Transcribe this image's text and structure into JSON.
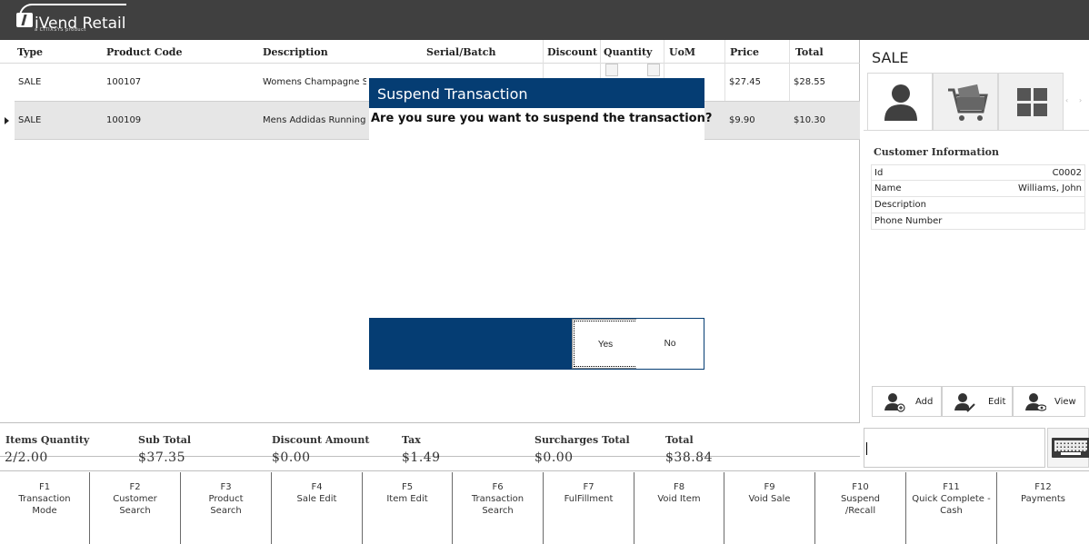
{
  "app": {
    "logo_text": "iVend Retail",
    "logo_sub": "a CITIXSYS product"
  },
  "grid": {
    "columns": [
      "Type",
      "Product Code",
      "Description",
      "Serial/Batch",
      "Discount",
      "Quantity",
      "UoM",
      "Price",
      "Total"
    ],
    "rows": [
      {
        "type": "SALE",
        "code": "100107",
        "description": "Womens Champagne S",
        "price": "$27.45",
        "total": "$28.55"
      },
      {
        "type": "SALE",
        "code": "100109",
        "description": "Mens Addidas Running",
        "price": "$9.90",
        "total": "$10.30"
      }
    ]
  },
  "right_panel": {
    "title": "SALE",
    "tabs": [
      "customer-icon",
      "cart-icon",
      "grid-icon"
    ],
    "customer_info_title": "Customer Information",
    "customer_info": [
      {
        "label": "Id",
        "value": "C0002"
      },
      {
        "label": "Name",
        "value": "Williams, John"
      },
      {
        "label": "Description",
        "value": ""
      },
      {
        "label": "Phone Number",
        "value": ""
      }
    ],
    "actions": {
      "add": "Add",
      "edit": "Edit",
      "view": "View"
    }
  },
  "totals": {
    "items_quantity": {
      "label": "Items Quantity",
      "value": "2/2.00"
    },
    "sub_total": {
      "label": "Sub Total",
      "value": "$37.35"
    },
    "discount_amount": {
      "label": "Discount Amount",
      "value": "$0.00"
    },
    "tax": {
      "label": "Tax",
      "value": "$1.49"
    },
    "surcharges_total": {
      "label": "Surcharges Total",
      "value": "$0.00"
    },
    "total": {
      "label": "Total",
      "value": "$38.84"
    }
  },
  "function_keys": [
    {
      "key": "F1",
      "label": "Transaction\nMode"
    },
    {
      "key": "F2",
      "label": "Customer\nSearch"
    },
    {
      "key": "F3",
      "label": "Product\nSearch"
    },
    {
      "key": "F4",
      "label": "Sale Edit"
    },
    {
      "key": "F5",
      "label": "Item Edit"
    },
    {
      "key": "F6",
      "label": "Transaction\nSearch"
    },
    {
      "key": "F7",
      "label": "FulFillment"
    },
    {
      "key": "F8",
      "label": "Void Item"
    },
    {
      "key": "F9",
      "label": "Void Sale"
    },
    {
      "key": "F10",
      "label": "Suspend\n/Recall"
    },
    {
      "key": "F11",
      "label": "Quick Complete -\nCash"
    },
    {
      "key": "F12",
      "label": "Payments"
    }
  ],
  "dialog": {
    "title": "Suspend Transaction",
    "message": "Are you sure you want to suspend the transaction?",
    "yes": "Yes",
    "no": "No"
  },
  "colors": {
    "topbar": "#404040",
    "dialog_blue": "#053d73"
  }
}
